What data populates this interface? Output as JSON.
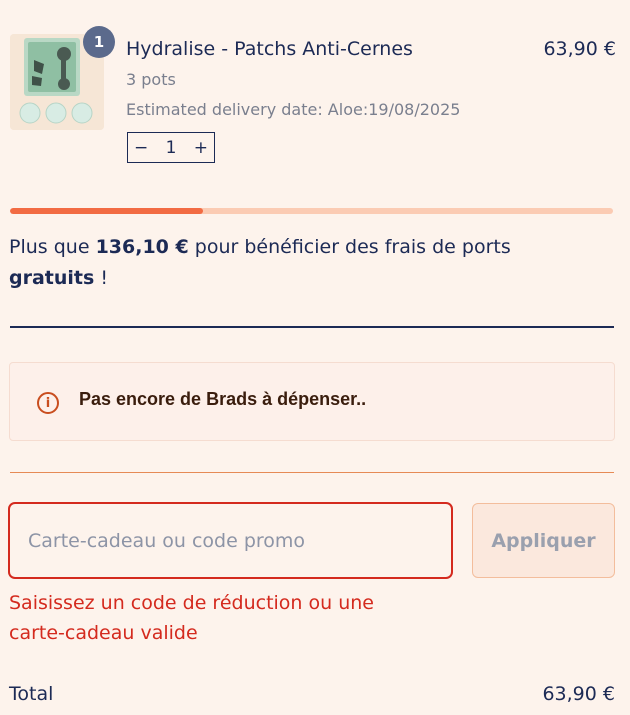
{
  "cart": {
    "item": {
      "name": "Hydralise - Patchs Anti-Cernes",
      "price": "63,90 €",
      "variant": "3 pots",
      "delivery": "Estimated delivery date: Aloe:19/08/2025",
      "badge_count": "1",
      "quantity": "1",
      "minus_label": "−",
      "plus_label": "+"
    }
  },
  "shipping": {
    "progress": 0.32,
    "prefix": "Plus que ",
    "amount": "136,10 €",
    "middle": " pour bénéficier des frais de ports ",
    "bold_word": "gratuits",
    "suffix": " !"
  },
  "brads": {
    "icon": "info-icon",
    "icon_glyph": "i",
    "message": "Pas encore de Brads à dépenser.."
  },
  "promo": {
    "placeholder": "Carte-cadeau ou code promo",
    "value": "",
    "apply_label": "Appliquer",
    "error": "Saisissez un code de réduction ou une carte-cadeau valide"
  },
  "total": {
    "label": "Total",
    "value": "63,90 €"
  },
  "colors": {
    "background": "#fdf3ec",
    "text": "#1c2a55",
    "accent": "#f26b43",
    "error": "#d42a1e"
  }
}
